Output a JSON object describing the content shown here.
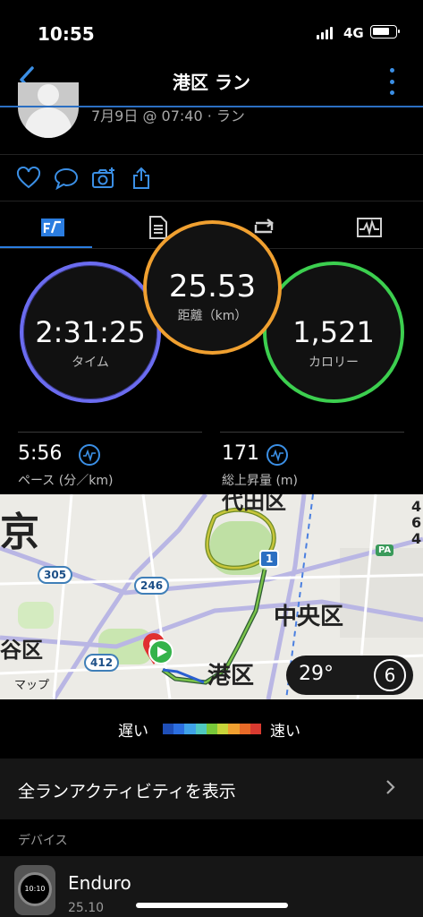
{
  "status_bar": {
    "time": "10:55",
    "network": "4G"
  },
  "nav": {
    "title": "港区 ラン"
  },
  "activity": {
    "date_time": "7月9日 @ 07:40 · ラン"
  },
  "actions": [
    "heart-icon",
    "comment-icon",
    "camera-icon",
    "share-icon"
  ],
  "tabs": [
    "summary-tab-icon",
    "details-tab-icon",
    "laps-tab-icon",
    "chart-tab-icon"
  ],
  "stats": {
    "time": {
      "value": "2:31:25",
      "label": "タイム"
    },
    "distance": {
      "value": "25.53",
      "label": "距離（km）"
    },
    "calories": {
      "value": "1,521",
      "label": "カロリー"
    },
    "pace": {
      "value": "5:56",
      "label": "ペース (分／km)"
    },
    "elevation": {
      "value": "171",
      "label": "総上昇量 (m)"
    }
  },
  "map": {
    "labels": {
      "kyo": "京",
      "chiyoda": "代田区",
      "chuo": "中央区",
      "minato": "港区",
      "shibuya": "谷区",
      "apple_maps": "マップ"
    },
    "route_shields": {
      "r305": "305",
      "r246": "246",
      "r412": "412",
      "r1": "1"
    },
    "edge_digits": [
      "4",
      "6",
      "4"
    ],
    "pa": "PA",
    "weather": {
      "temp": "29°",
      "wind": "6"
    }
  },
  "legend": {
    "slow": "遅い",
    "fast": "速い",
    "colors": [
      "#1f4fb8",
      "#2c6fe0",
      "#3fa2e8",
      "#4fc8c0",
      "#78c83a",
      "#c8d43a",
      "#f0a030",
      "#e86a28",
      "#d83a30"
    ]
  },
  "list": {
    "all_runs": "全ランアクティビティを表示",
    "devices_header": "デバイス",
    "device_name": "Enduro",
    "device_version": "25.10",
    "watch_face_text": "10:10"
  },
  "colors": {
    "accent": "#3b8fe5",
    "time_ring": "#6b6cf0",
    "distance_ring": "#f0a030",
    "calories_ring": "#3ccf4f"
  }
}
